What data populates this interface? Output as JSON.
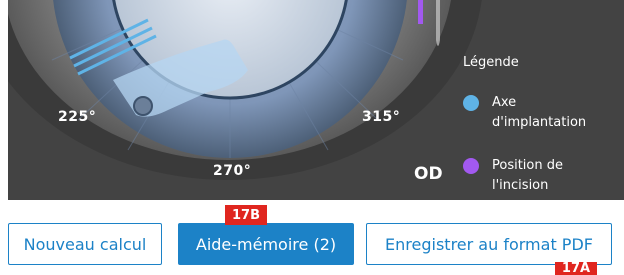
{
  "angles": {
    "a225": "225°",
    "a315": "315°",
    "a270": "270°"
  },
  "eye_side": "OD",
  "legend": {
    "title": "Légende",
    "items": [
      {
        "label_line1": "Axe",
        "label_line2": "d'implantation",
        "color": "#5fb3e6"
      },
      {
        "label_line1": "Position de",
        "label_line2": "l'incision",
        "color": "#a259f0"
      }
    ]
  },
  "buttons": {
    "new": "Nouveau calcul",
    "memo": "Aide-mémoire (2)",
    "pdf": "Enregistrer au format PDF"
  },
  "tags": {
    "b": "17B",
    "a": "17A"
  },
  "colors": {
    "accent": "#1c82c7",
    "tag": "#e0261f",
    "background_dark": "#434343"
  }
}
